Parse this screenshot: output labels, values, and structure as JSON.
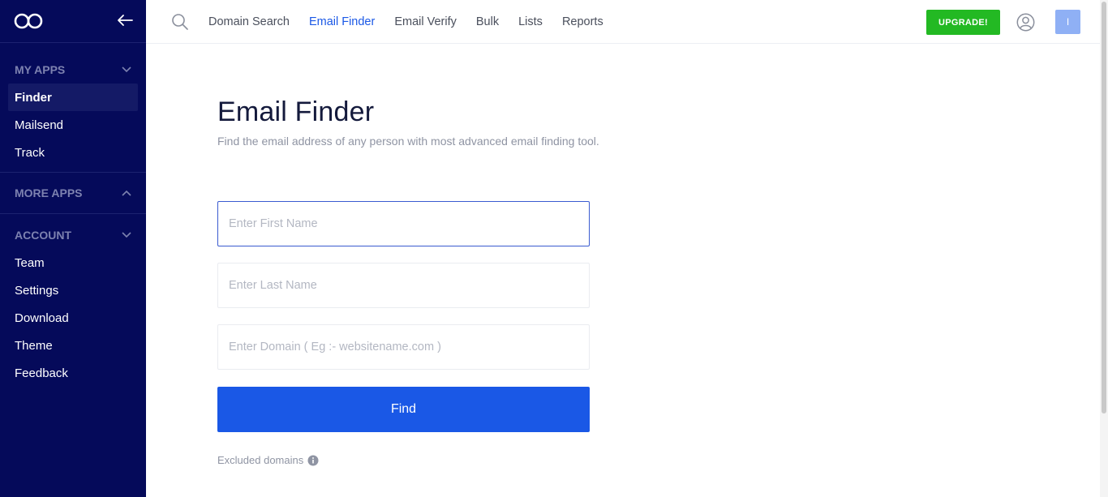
{
  "sidebar": {
    "sections": {
      "my_apps": {
        "title": "MY APPS",
        "items": [
          "Finder",
          "Mailsend",
          "Track"
        ]
      },
      "more_apps": {
        "title": "MORE APPS"
      },
      "account": {
        "title": "ACCOUNT",
        "items": [
          "Team",
          "Settings",
          "Download",
          "Theme",
          "Feedback"
        ]
      }
    },
    "active_item": "Finder"
  },
  "topbar": {
    "nav": [
      "Domain Search",
      "Email Finder",
      "Email Verify",
      "Bulk",
      "Lists",
      "Reports"
    ],
    "active_nav": "Email Finder",
    "upgrade_label": "UPGRADE!",
    "avatar_initial": "I"
  },
  "main": {
    "title": "Email Finder",
    "subtitle": "Find the email address of any person with most advanced email finding tool.",
    "first_name_placeholder": "Enter First Name",
    "last_name_placeholder": "Enter Last Name",
    "domain_placeholder": "Enter Domain ( Eg :- websitename.com )",
    "find_label": "Find",
    "excluded_label": "Excluded domains"
  },
  "colors": {
    "sidebar_bg": "#050a5a",
    "accent": "#1a58e6",
    "upgrade": "#23b923",
    "avatar": "#8fb0f5"
  }
}
